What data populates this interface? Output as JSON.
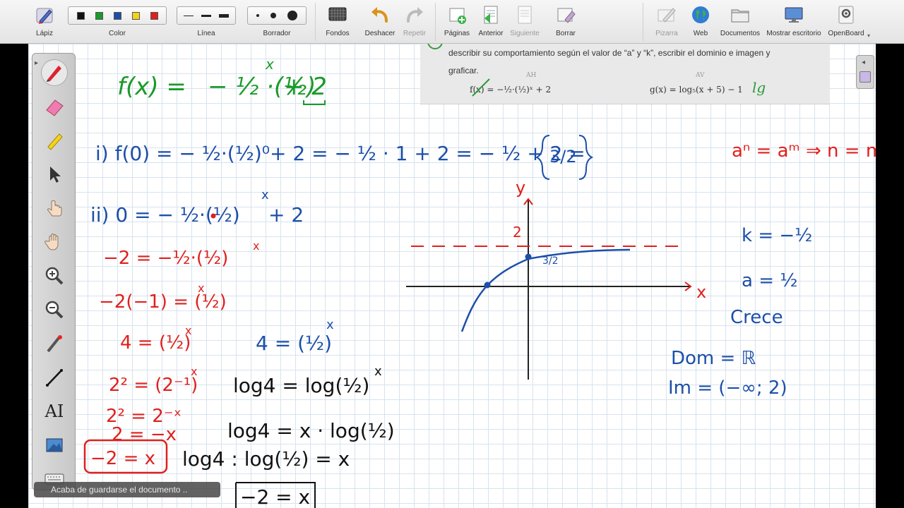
{
  "toolbar": {
    "items": {
      "pencil": "Lápiz",
      "color": "Color",
      "line": "Línea",
      "eraser": "Borrador",
      "backgrounds": "Fondos",
      "undo": "Deshacer",
      "redo": "Repetir",
      "pages": "Páginas",
      "previous": "Anterior",
      "next": "Siguiente",
      "clear": "Borrar",
      "board": "Pizarra",
      "web": "Web",
      "documents": "Documentos",
      "show_desktop": "Mostrar escritorio",
      "app": "OpenBoard"
    },
    "colors": [
      "#111111",
      "#1a9a2a",
      "#1c4fa8",
      "#f2d21c",
      "#e0201c"
    ],
    "disabled": [
      "redo",
      "next",
      "board"
    ]
  },
  "exercise": {
    "line1": "describir su comportamiento según el valor de “a” y “k”, escribir el dominio e imagen y",
    "line2": "graficar.",
    "f_formula": "f(x) = −½·(½)ˣ + 2",
    "g_formula": "g(x) = log₅(x + 5) − 1",
    "f_note": "AH",
    "g_note": "AV",
    "g_mark": "lg"
  },
  "handwriting": {
    "line_f": "f(x) = −½·(½)ˣ + 2",
    "line_i": "i) f(0) = −½·(½)⁰ + 2  = −½ · 1 + 2 = −½ + 2 = 3/2",
    "line_ii": "ii)  0 = −½·(½)ˣ + 2",
    "red_steps": [
      "−2 = −½·(½)ˣ",
      "−2(−1) = (½)ˣ",
      "4 = (½)ˣ",
      "2² = (2⁻¹)ˣ",
      "2² = 2⁻ˣ",
      "2 = −x",
      "−2 = x"
    ],
    "blue_steps": [
      "4 = (½)ˣ",
      "log4 = log(½)ˣ",
      "log4 = x · log(½)",
      "log4 : log(½) = x",
      "−2 = x"
    ],
    "red_rule": "aⁿ = aᵐ ⇒ n = m",
    "side_notes": [
      "k = −½",
      "a = ½",
      "Crece",
      "Dom = ℝ",
      "Im = (−∞; 2)"
    ],
    "graph_labels": {
      "y": "y",
      "x": "x",
      "two": "2",
      "three_half": "3/2"
    }
  },
  "status": {
    "toast": "Acaba de guardarse el documento .."
  }
}
